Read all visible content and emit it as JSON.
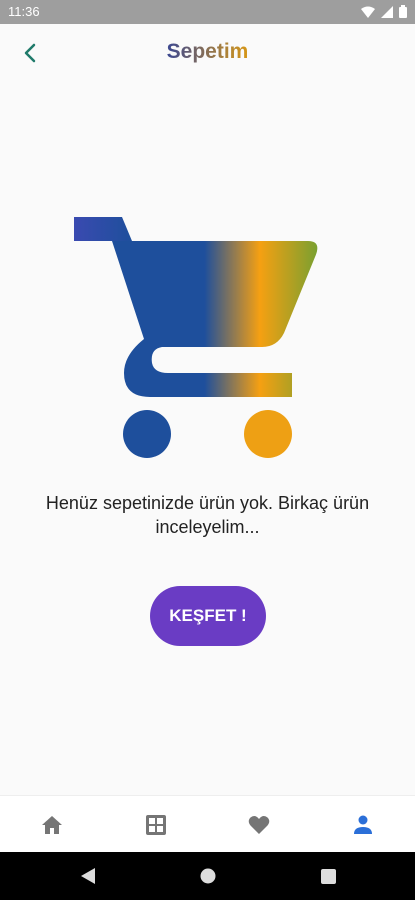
{
  "status_bar": {
    "time": "11:36"
  },
  "app_bar": {
    "title": "Sepetim"
  },
  "empty_state": {
    "message": "Henüz sepetinizde ürün yok. Birkaç ürün inceleyelim...",
    "button_label": "KEŞFET !"
  },
  "colors": {
    "accent": "#6a3cc4",
    "gradient_start": "#1e4f9c",
    "gradient_mid": "#f5a012",
    "gradient_end": "#7aa030",
    "active_nav": "#2b6fd8",
    "inactive_nav": "#757575"
  },
  "bottom_nav": {
    "items": [
      {
        "icon": "home-icon",
        "active": false
      },
      {
        "icon": "grid-icon",
        "active": false
      },
      {
        "icon": "heart-icon",
        "active": false
      },
      {
        "icon": "person-icon",
        "active": true
      }
    ]
  },
  "system_nav": {
    "items": [
      "back-icon",
      "home-circle-icon",
      "recents-icon"
    ]
  }
}
